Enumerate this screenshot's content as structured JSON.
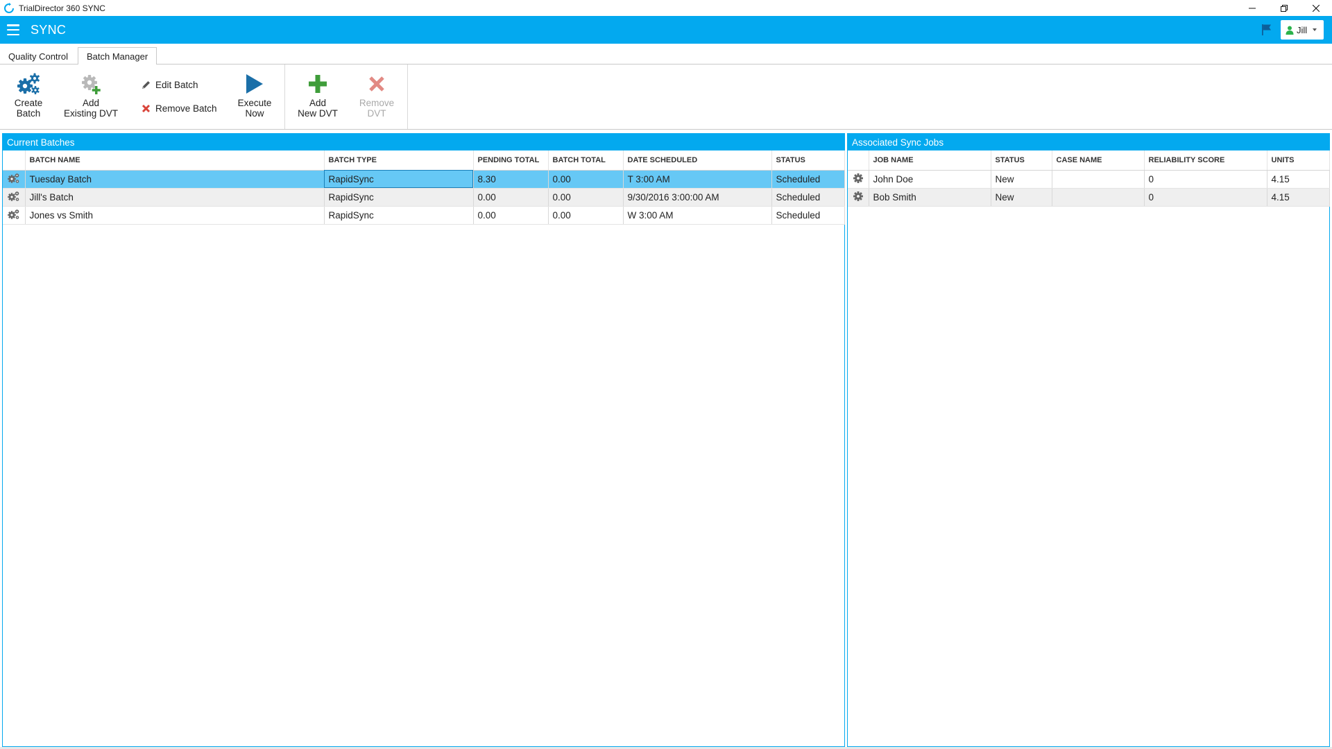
{
  "window": {
    "title": "TrialDirector 360 SYNC",
    "icon": "sync-icon",
    "controls": [
      "minimize-icon",
      "restore-icon",
      "close-icon"
    ]
  },
  "appbar": {
    "name": "SYNC",
    "user": "Jill",
    "accent": "#03a9ef"
  },
  "tabs": [
    {
      "label": "Quality Control",
      "active": false
    },
    {
      "label": "Batch Manager",
      "active": true
    }
  ],
  "ribbon": {
    "create_batch": "Create\nBatch",
    "add_existing_dvt": "Add\nExisting DVT",
    "edit_batch": "Edit Batch",
    "remove_batch": "Remove Batch",
    "execute_now": "Execute\nNow",
    "add_new_dvt": "Add\nNew DVT",
    "remove_dvt": "Remove\nDVT"
  },
  "current_batches": {
    "title": "Current Batches",
    "columns": [
      "BATCH NAME",
      "BATCH TYPE",
      "PENDING TOTAL",
      "BATCH TOTAL",
      "DATE SCHEDULED",
      "STATUS"
    ],
    "rows": [
      {
        "name": "Tuesday Batch",
        "type": "RapidSync",
        "pending": "8.30",
        "total": "0.00",
        "date": "T 3:00 AM",
        "status": "Scheduled"
      },
      {
        "name": "Jill's Batch",
        "type": "RapidSync",
        "pending": "0.00",
        "total": "0.00",
        "date": "9/30/2016 3:00:00 AM",
        "status": "Scheduled"
      },
      {
        "name": "Jones vs Smith",
        "type": "RapidSync",
        "pending": "0.00",
        "total": "0.00",
        "date": "W 3:00 AM",
        "status": "Scheduled"
      }
    ]
  },
  "associated_jobs": {
    "title": "Associated Sync Jobs",
    "columns": [
      "JOB NAME",
      "STATUS",
      "CASE NAME",
      "RELIABILITY SCORE",
      "UNITS"
    ],
    "rows": [
      {
        "name": "John Doe",
        "status": "New",
        "case": "",
        "score": "0",
        "units": "4.15"
      },
      {
        "name": "Bob Smith",
        "status": "New",
        "case": "",
        "score": "0",
        "units": "4.15"
      }
    ]
  }
}
